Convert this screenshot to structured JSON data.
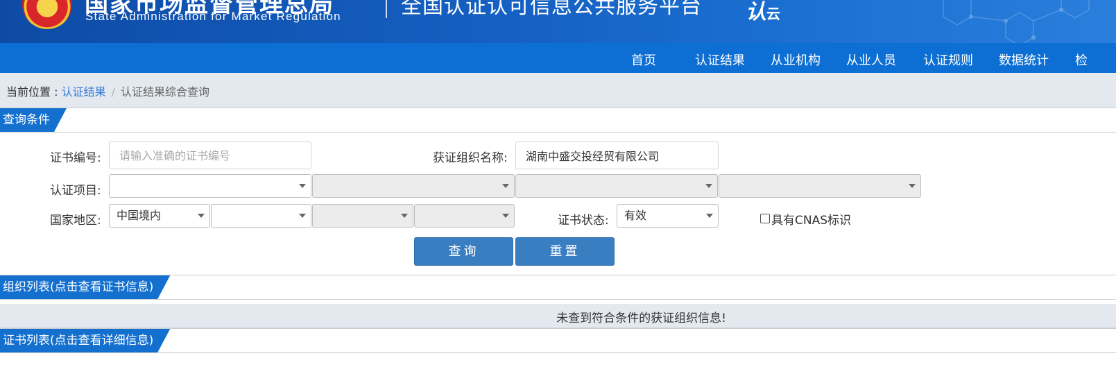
{
  "header": {
    "agency_cn": "国家市场监督管理总局",
    "agency_en": "State Administration  for  Market Regulation",
    "platform_title": "全国认证认可信息公共服务平台",
    "cloud_logo_main": "认",
    "cloud_logo_small": "云"
  },
  "nav": {
    "items": [
      "首页",
      "认证结果",
      "从业机构",
      "从业人员",
      "认证规则",
      "数据统计",
      "检"
    ]
  },
  "breadcrumb": {
    "prefix": "当前位置 : ",
    "link": "认证结果",
    "separator": "/",
    "current": "认证结果综合查询"
  },
  "query_section": {
    "title": "查询条件",
    "cert_no_label": "证书编号:",
    "cert_no_placeholder": "请输入准确的证书编号",
    "org_name_label": "获证组织名称:",
    "org_name_value": "湖南中盛交投经贸有限公司",
    "project_label": "认证项目:",
    "region_label": "国家地区:",
    "region_value": "中国境内",
    "status_label": "证书状态:",
    "status_value": "有效",
    "cnas_label": "具有CNAS标识",
    "query_button": "查询",
    "reset_button": "重置"
  },
  "org_list": {
    "title": "组织列表(点击查看证书信息)",
    "empty_message": "未查到符合条件的获证组织信息!"
  },
  "cert_list": {
    "title": "证书列表(点击查看详细信息)"
  },
  "colors": {
    "nav_bg": "#0d6fd4",
    "section_tab": "#1470cf",
    "button": "#3a7ec2",
    "breadcrumb_link": "#3a7bd5"
  }
}
